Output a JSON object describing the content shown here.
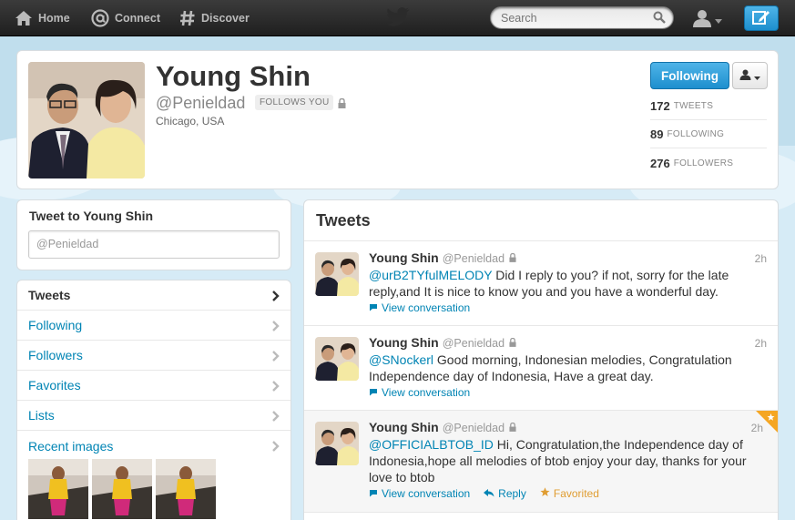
{
  "topbar": {
    "home": "Home",
    "connect": "Connect",
    "discover": "Discover",
    "search_placeholder": "Search"
  },
  "profile": {
    "name": "Young Shin",
    "handle": "@Penieldad",
    "follows_you": "FOLLOWS YOU",
    "location": "Chicago, USA",
    "following_button": "Following",
    "stats": [
      {
        "num": "172",
        "label": "TWEETS"
      },
      {
        "num": "89",
        "label": "FOLLOWING"
      },
      {
        "num": "276",
        "label": "FOLLOWERS"
      }
    ]
  },
  "tweet_to": {
    "title": "Tweet to Young Shin",
    "prefill": "@Penieldad"
  },
  "menu": [
    {
      "label": "Tweets"
    },
    {
      "label": "Following"
    },
    {
      "label": "Followers"
    },
    {
      "label": "Favorites"
    },
    {
      "label": "Lists"
    },
    {
      "label": "Recent images"
    }
  ],
  "tweets_heading": "Tweets",
  "tweets": [
    {
      "name": "Young Shin",
      "handle": "@Penieldad",
      "time": "2h",
      "mention": "@urB2TYfulMELODY",
      "text": " Did I reply to you? if not, sorry for the late reply,and It is nice to know you and you have a wonderful day.",
      "view": "View conversation"
    },
    {
      "name": "Young Shin",
      "handle": "@Penieldad",
      "time": "2h",
      "mention": "@SNockerl",
      "text": " Good morning, Indonesian melodies, Congratulation Independence day of Indonesia, Have a great day.",
      "view": "View conversation"
    },
    {
      "name": "Young Shin",
      "handle": "@Penieldad",
      "time": "2h",
      "mention": "@OFFICIALBTOB_ID",
      "text": " Hi, Congratulation,the Independence day of Indonesia,hope all melodies of btob enjoy your day, thanks for your love to btob",
      "view": "View conversation",
      "reply": "Reply",
      "favorited": "Favorited"
    }
  ],
  "colors": {
    "link": "#0084b4",
    "button_blue": "#1d8fce",
    "favorite": "#e09d32",
    "background": "#c0deed"
  }
}
